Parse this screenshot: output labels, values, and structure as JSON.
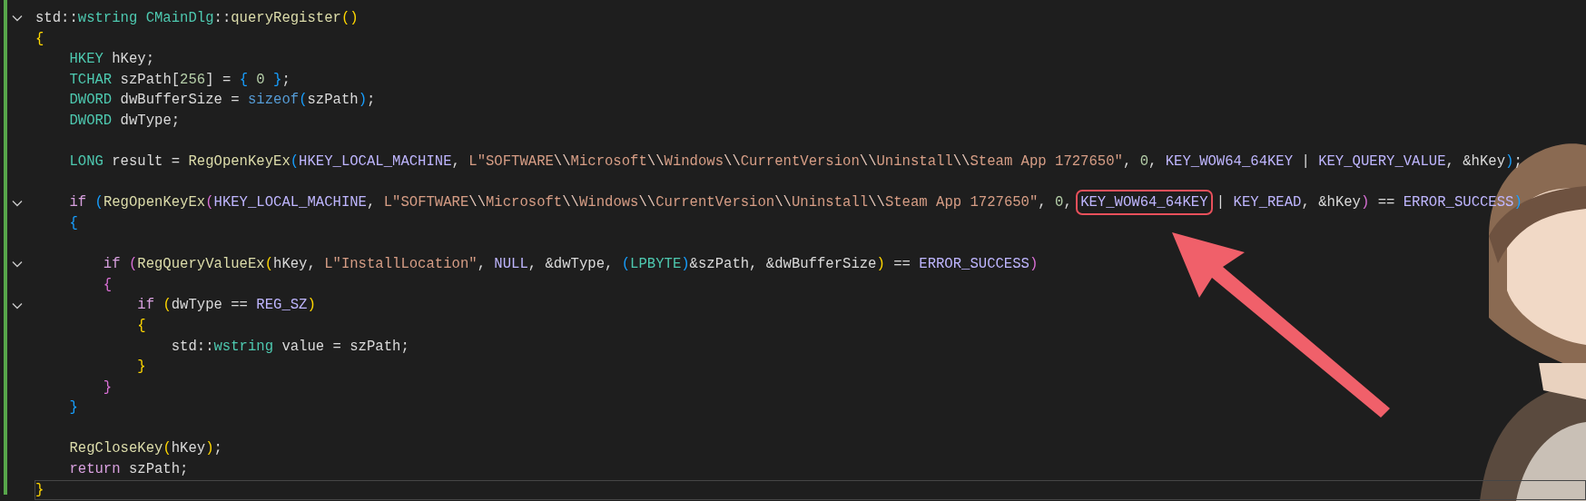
{
  "editor": {
    "lines": [
      {
        "kind": "code",
        "foldable": true,
        "current": false,
        "tokens": [
          {
            "kind": "p",
            "text": "std::"
          },
          {
            "kind": "ty",
            "text": "wstring CMainDlg"
          },
          {
            "kind": "p",
            "text": "::"
          },
          {
            "kind": "fn",
            "text": "queryRegister"
          },
          {
            "kind": "b1",
            "text": "()"
          }
        ]
      },
      {
        "kind": "code",
        "foldable": false,
        "current": false,
        "tokens": [
          {
            "kind": "b1",
            "text": "{"
          }
        ]
      },
      {
        "kind": "code",
        "foldable": false,
        "current": false,
        "tokens": [
          {
            "kind": "ty",
            "text": "    HKEY"
          },
          {
            "kind": "p",
            "text": " hKey;"
          }
        ]
      },
      {
        "kind": "code",
        "foldable": false,
        "current": false,
        "tokens": [
          {
            "kind": "ty",
            "text": "    TCHAR"
          },
          {
            "kind": "p",
            "text": " szPath["
          },
          {
            "kind": "num",
            "text": "256"
          },
          {
            "kind": "p",
            "text": "] = "
          },
          {
            "kind": "b3",
            "text": "{ "
          },
          {
            "kind": "num",
            "text": "0"
          },
          {
            "kind": "b3",
            "text": " }"
          },
          {
            "kind": "p",
            "text": ";"
          }
        ]
      },
      {
        "kind": "code",
        "foldable": false,
        "current": false,
        "tokens": [
          {
            "kind": "ty",
            "text": "    DWORD"
          },
          {
            "kind": "p",
            "text": " dwBufferSize = "
          },
          {
            "kind": "kw",
            "text": "sizeof"
          },
          {
            "kind": "b3",
            "text": "("
          },
          {
            "kind": "p",
            "text": "szPath"
          },
          {
            "kind": "b3",
            "text": ")"
          },
          {
            "kind": "p",
            "text": ";"
          }
        ]
      },
      {
        "kind": "code",
        "foldable": false,
        "current": false,
        "tokens": [
          {
            "kind": "ty",
            "text": "    DWORD"
          },
          {
            "kind": "p",
            "text": " dwType;"
          }
        ]
      },
      {
        "kind": "blank"
      },
      {
        "kind": "code",
        "foldable": false,
        "current": false,
        "tokens": [
          {
            "kind": "ty",
            "text": "    LONG"
          },
          {
            "kind": "p",
            "text": " result = "
          },
          {
            "kind": "fn",
            "text": "RegOpenKeyEx"
          },
          {
            "kind": "b3",
            "text": "("
          },
          {
            "kind": "mac",
            "text": "HKEY_LOCAL_MACHINE"
          },
          {
            "kind": "p",
            "text": ", "
          },
          {
            "kind": "str",
            "text": "L\"SOFTWARE"
          },
          {
            "kind": "esc",
            "text": "\\\\"
          },
          {
            "kind": "str",
            "text": "Microsoft"
          },
          {
            "kind": "esc",
            "text": "\\\\"
          },
          {
            "kind": "str",
            "text": "Windows"
          },
          {
            "kind": "esc",
            "text": "\\\\"
          },
          {
            "kind": "str",
            "text": "CurrentVersion"
          },
          {
            "kind": "esc",
            "text": "\\\\"
          },
          {
            "kind": "str",
            "text": "Uninstall"
          },
          {
            "kind": "esc",
            "text": "\\\\"
          },
          {
            "kind": "str",
            "text": "Steam App 1727650\""
          },
          {
            "kind": "p",
            "text": ", "
          },
          {
            "kind": "num",
            "text": "0"
          },
          {
            "kind": "p",
            "text": ", "
          },
          {
            "kind": "mac",
            "text": "KEY_WOW64_64KEY"
          },
          {
            "kind": "p",
            "text": " | "
          },
          {
            "kind": "mac",
            "text": "KEY_QUERY_VALUE"
          },
          {
            "kind": "p",
            "text": ", &hKey"
          },
          {
            "kind": "b3",
            "text": ")"
          },
          {
            "kind": "p",
            "text": ";"
          }
        ]
      },
      {
        "kind": "blank"
      },
      {
        "kind": "code",
        "foldable": true,
        "current": false,
        "tokens": [
          {
            "kind": "ctl",
            "text": "    if "
          },
          {
            "kind": "b3",
            "text": "("
          },
          {
            "kind": "fn",
            "text": "RegOpenKeyEx"
          },
          {
            "kind": "b2",
            "text": "("
          },
          {
            "kind": "mac",
            "text": "HKEY_LOCAL_MACHINE"
          },
          {
            "kind": "p",
            "text": ", "
          },
          {
            "kind": "str",
            "text": "L\"SOFTWARE"
          },
          {
            "kind": "esc",
            "text": "\\\\"
          },
          {
            "kind": "str",
            "text": "Microsoft"
          },
          {
            "kind": "esc",
            "text": "\\\\"
          },
          {
            "kind": "str",
            "text": "Windows"
          },
          {
            "kind": "esc",
            "text": "\\\\"
          },
          {
            "kind": "str",
            "text": "CurrentVersion"
          },
          {
            "kind": "esc",
            "text": "\\\\"
          },
          {
            "kind": "str",
            "text": "Uninstall"
          },
          {
            "kind": "esc",
            "text": "\\\\"
          },
          {
            "kind": "str",
            "text": "Steam App 1727650\""
          },
          {
            "kind": "p",
            "text": ", "
          },
          {
            "kind": "num",
            "text": "0"
          },
          {
            "kind": "p",
            "text": ", "
          },
          {
            "kind": "mac",
            "text": "KEY_WOW64_64KEY",
            "highlighted": true
          },
          {
            "kind": "p",
            "text": " | "
          },
          {
            "kind": "mac",
            "text": "KEY_READ"
          },
          {
            "kind": "p",
            "text": ", &hKey"
          },
          {
            "kind": "b2",
            "text": ")"
          },
          {
            "kind": "p",
            "text": " == "
          },
          {
            "kind": "mac",
            "text": "ERROR_SUCCESS"
          },
          {
            "kind": "b3",
            "text": ")"
          }
        ]
      },
      {
        "kind": "code",
        "foldable": false,
        "current": false,
        "tokens": [
          {
            "kind": "b3",
            "text": "    {"
          }
        ]
      },
      {
        "kind": "blank"
      },
      {
        "kind": "code",
        "foldable": true,
        "current": false,
        "tokens": [
          {
            "kind": "ctl",
            "text": "        if "
          },
          {
            "kind": "b2",
            "text": "("
          },
          {
            "kind": "fn",
            "text": "RegQueryValueEx"
          },
          {
            "kind": "b1",
            "text": "("
          },
          {
            "kind": "p",
            "text": "hKey, "
          },
          {
            "kind": "str",
            "text": "L\"InstallLocation\""
          },
          {
            "kind": "p",
            "text": ", "
          },
          {
            "kind": "mac",
            "text": "NULL"
          },
          {
            "kind": "p",
            "text": ", &dwType, "
          },
          {
            "kind": "b3",
            "text": "("
          },
          {
            "kind": "ty",
            "text": "LPBYTE"
          },
          {
            "kind": "b3",
            "text": ")"
          },
          {
            "kind": "p",
            "text": "&szPath, &dwBufferSize"
          },
          {
            "kind": "b1",
            "text": ")"
          },
          {
            "kind": "p",
            "text": " == "
          },
          {
            "kind": "mac",
            "text": "ERROR_SUCCESS"
          },
          {
            "kind": "b2",
            "text": ")"
          }
        ]
      },
      {
        "kind": "code",
        "foldable": false,
        "current": false,
        "tokens": [
          {
            "kind": "b2",
            "text": "        {"
          }
        ]
      },
      {
        "kind": "code",
        "foldable": true,
        "current": false,
        "tokens": [
          {
            "kind": "ctl",
            "text": "            if "
          },
          {
            "kind": "b1",
            "text": "("
          },
          {
            "kind": "p",
            "text": "dwType == "
          },
          {
            "kind": "mac",
            "text": "REG_SZ"
          },
          {
            "kind": "b1",
            "text": ")"
          }
        ]
      },
      {
        "kind": "code",
        "foldable": false,
        "current": false,
        "tokens": [
          {
            "kind": "b1",
            "text": "            {"
          }
        ]
      },
      {
        "kind": "code",
        "foldable": false,
        "current": false,
        "tokens": [
          {
            "kind": "p",
            "text": "                std::"
          },
          {
            "kind": "ty",
            "text": "wstring"
          },
          {
            "kind": "p",
            "text": " value = szPath;"
          }
        ]
      },
      {
        "kind": "code",
        "foldable": false,
        "current": false,
        "tokens": [
          {
            "kind": "b1",
            "text": "            }"
          }
        ]
      },
      {
        "kind": "code",
        "foldable": false,
        "current": false,
        "tokens": [
          {
            "kind": "b2",
            "text": "        }"
          }
        ]
      },
      {
        "kind": "code",
        "foldable": false,
        "current": false,
        "tokens": [
          {
            "kind": "b3",
            "text": "    }"
          }
        ]
      },
      {
        "kind": "blank"
      },
      {
        "kind": "code",
        "foldable": false,
        "current": false,
        "tokens": [
          {
            "kind": "fn",
            "text": "    RegCloseKey"
          },
          {
            "kind": "b1",
            "text": "("
          },
          {
            "kind": "p",
            "text": "hKey"
          },
          {
            "kind": "b1",
            "text": ")"
          },
          {
            "kind": "p",
            "text": ";"
          }
        ]
      },
      {
        "kind": "code",
        "foldable": false,
        "current": false,
        "tokens": [
          {
            "kind": "ctl",
            "text": "    return"
          },
          {
            "kind": "p",
            "text": " szPath;"
          }
        ]
      },
      {
        "kind": "code",
        "foldable": false,
        "current": true,
        "tokens": [
          {
            "kind": "b1",
            "text": "}"
          }
        ]
      }
    ]
  }
}
